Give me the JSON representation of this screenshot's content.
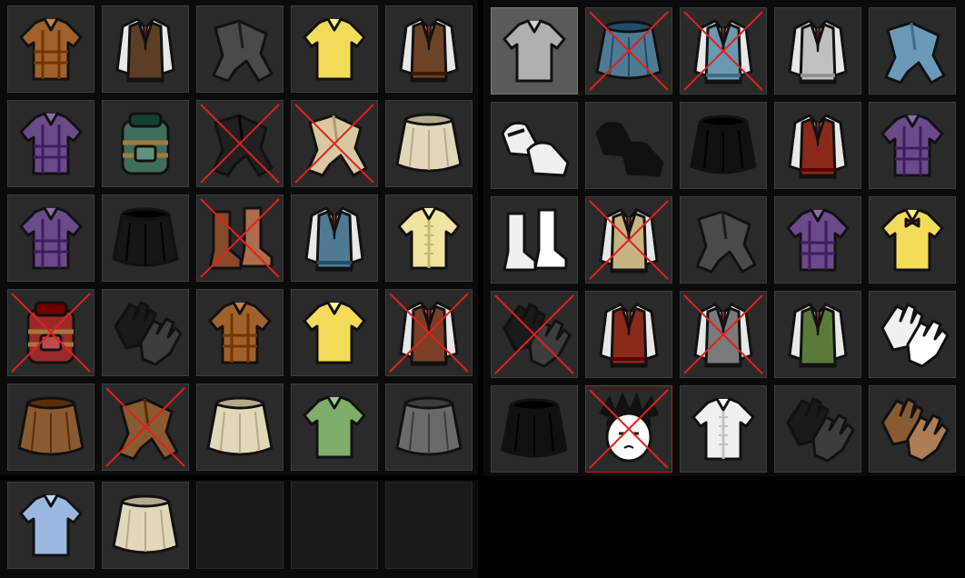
{
  "inventory": {
    "left_slots": [
      {
        "item": "plaid-shirt",
        "color": "#a0622a",
        "crossed": false
      },
      {
        "item": "vest-suit",
        "color": "#5a3f25",
        "crossed": false
      },
      {
        "item": "pants",
        "color": "#4a4a4a",
        "crossed": false
      },
      {
        "item": "polo-shirt",
        "color": "#f3dc5a",
        "crossed": false
      },
      {
        "item": "sweater-vest",
        "color": "#6b4426",
        "crossed": false
      },
      {
        "item": "plaid-shirt",
        "color": "#6a4a8a",
        "crossed": false
      },
      {
        "item": "backpack",
        "color": "#3f6f5a",
        "crossed": false
      },
      {
        "item": "pants",
        "color": "#202020",
        "crossed": true
      },
      {
        "item": "pants",
        "color": "#d9c8a0",
        "crossed": true
      },
      {
        "item": "skirt",
        "color": "#e0d8b8",
        "crossed": false
      },
      {
        "item": "plaid-shirt",
        "color": "#6a4a8a",
        "crossed": false
      },
      {
        "item": "skirt",
        "color": "#151515",
        "crossed": false
      },
      {
        "item": "boots",
        "color": "#8a4a2a",
        "crossed": true
      },
      {
        "item": "sweater-vest",
        "color": "#4f7a94",
        "crossed": false
      },
      {
        "item": "frilly-shirt",
        "color": "#f0e4a0",
        "crossed": false
      },
      {
        "item": "backpack",
        "color": "#9a2a2a",
        "crossed": true
      },
      {
        "item": "gloves",
        "color": "#1a1a1a",
        "crossed": false
      },
      {
        "item": "plaid-shirt",
        "color": "#a0622a",
        "crossed": false
      },
      {
        "item": "polo-shirt",
        "color": "#f3dc5a",
        "crossed": false
      },
      {
        "item": "coat",
        "color": "#7a3f25",
        "crossed": true
      },
      {
        "item": "skirt",
        "color": "#8a5a30",
        "crossed": false
      },
      {
        "item": "pants",
        "color": "#8a5a30",
        "crossed": true
      },
      {
        "item": "skirt",
        "color": "#e0d8b8",
        "crossed": false
      },
      {
        "item": "shirt",
        "color": "#7fae6a",
        "crossed": false
      },
      {
        "item": "skirt",
        "color": "#6a6a6a",
        "crossed": false
      },
      {
        "item": "shirt",
        "color": "#9ab8e0",
        "crossed": false
      },
      {
        "item": "skirt",
        "color": "#e0d8b8",
        "crossed": false
      },
      {
        "item": "empty",
        "color": "#1a1a1a",
        "crossed": false
      },
      {
        "item": "empty",
        "color": "#1a1a1a",
        "crossed": false
      },
      {
        "item": "empty",
        "color": "#1a1a1a",
        "crossed": false
      }
    ],
    "right_slots": [
      {
        "item": "tshirt",
        "color": "#b0b0b0",
        "crossed": false
      },
      {
        "item": "skirt",
        "color": "#4f7a94",
        "crossed": true
      },
      {
        "item": "sweater-vest",
        "color": "#6a9ab0",
        "crossed": true
      },
      {
        "item": "sweater-vest",
        "color": "#c0c0c0",
        "crossed": false
      },
      {
        "item": "pants",
        "color": "#6a9ab8",
        "crossed": false
      },
      {
        "item": "shoes",
        "color": "#f0f0f0",
        "crossed": false
      },
      {
        "item": "heels",
        "color": "#101010",
        "crossed": false
      },
      {
        "item": "skirt",
        "color": "#101010",
        "crossed": false
      },
      {
        "item": "sweater-vest",
        "color": "#8a2a1a",
        "crossed": false
      },
      {
        "item": "plaid-shirt",
        "color": "#6a4a8a",
        "crossed": false
      },
      {
        "item": "boots",
        "color": "#f0f0f0",
        "crossed": false
      },
      {
        "item": "vest-suit",
        "color": "#c8b480",
        "crossed": true
      },
      {
        "item": "pants",
        "color": "#4a4a4a",
        "crossed": false
      },
      {
        "item": "plaid-shirt",
        "color": "#6a4a8a",
        "crossed": false
      },
      {
        "item": "bowtie-shirt",
        "color": "#f3dc5a",
        "crossed": false
      },
      {
        "item": "gloves",
        "color": "#1a1a1a",
        "crossed": true
      },
      {
        "item": "sweater-vest",
        "color": "#8a2a1a",
        "crossed": false
      },
      {
        "item": "vest-suit",
        "color": "#7a7a7a",
        "crossed": true
      },
      {
        "item": "vest-suit",
        "color": "#5a7a3a",
        "crossed": false
      },
      {
        "item": "gloves",
        "color": "#f0f0f0",
        "crossed": false
      },
      {
        "item": "skirt",
        "color": "#101010",
        "crossed": false
      },
      {
        "item": "character-head",
        "color": "#ffffff",
        "crossed": true
      },
      {
        "item": "frilly-shirt",
        "color": "#f0f0f0",
        "crossed": false
      },
      {
        "item": "gloves",
        "color": "#1a1a1a",
        "crossed": false
      },
      {
        "item": "gloves",
        "color": "#8a5a30",
        "crossed": false
      }
    ],
    "cross_color": "#e02020"
  }
}
